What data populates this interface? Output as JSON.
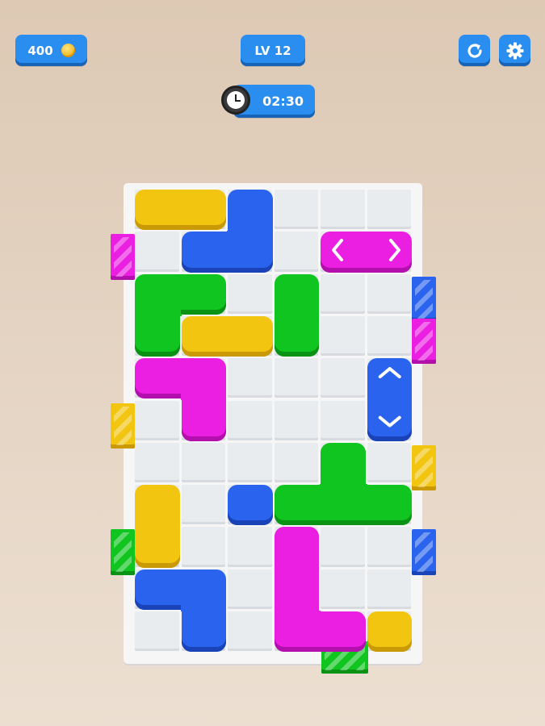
{
  "hud": {
    "coins": "400",
    "level": "LV 12",
    "timer": "02:30"
  },
  "icons": [
    "coin-icon",
    "clock-icon",
    "restart-icon",
    "settings-icon",
    "arrow-left-icon",
    "arrow-right-icon",
    "arrow-up-icon",
    "arrow-down-icon"
  ],
  "colors": {
    "yellow": "#f1c40f",
    "blue": "#2866f0",
    "green": "#0bc21f",
    "magenta": "#e81be0",
    "hud_blue": "#2a8ef0"
  },
  "board": {
    "columns": 6,
    "rows": 11,
    "pieces": [
      {
        "id": "yellow-bar-top",
        "color": "yellow",
        "cells": [
          [
            0,
            0
          ],
          [
            1,
            0
          ]
        ]
      },
      {
        "id": "blue-corner-top",
        "color": "blue",
        "cells": [
          [
            2,
            0
          ],
          [
            2,
            1
          ],
          [
            1,
            1
          ]
        ]
      },
      {
        "id": "magenta-horizontal-arrows",
        "color": "magenta",
        "cells": [
          [
            4,
            1
          ],
          [
            5,
            1
          ]
        ],
        "arrows": "horizontal"
      },
      {
        "id": "green-corner-left",
        "color": "green",
        "cells": [
          [
            0,
            2
          ],
          [
            1,
            2
          ],
          [
            0,
            3
          ]
        ]
      },
      {
        "id": "yellow-bar-middle",
        "color": "yellow",
        "cells": [
          [
            1,
            3
          ],
          [
            2,
            3
          ]
        ]
      },
      {
        "id": "green-vertical",
        "color": "green",
        "cells": [
          [
            3,
            2
          ],
          [
            3,
            3
          ]
        ]
      },
      {
        "id": "magenta-corner",
        "color": "magenta",
        "cells": [
          [
            0,
            4
          ],
          [
            1,
            4
          ],
          [
            1,
            5
          ]
        ]
      },
      {
        "id": "blue-vertical-arrows",
        "color": "blue",
        "cells": [
          [
            5,
            4
          ],
          [
            5,
            5
          ]
        ],
        "arrows": "vertical"
      },
      {
        "id": "green-t",
        "color": "green",
        "cells": [
          [
            4,
            6
          ],
          [
            3,
            7
          ],
          [
            4,
            7
          ],
          [
            5,
            7
          ]
        ]
      },
      {
        "id": "blue-single",
        "color": "blue",
        "cells": [
          [
            2,
            7
          ]
        ]
      },
      {
        "id": "yellow-vertical",
        "color": "yellow",
        "cells": [
          [
            0,
            7
          ],
          [
            0,
            8
          ]
        ]
      },
      {
        "id": "magenta-l",
        "color": "magenta",
        "cells": [
          [
            3,
            8
          ],
          [
            3,
            9
          ],
          [
            3,
            10
          ],
          [
            4,
            10
          ]
        ]
      },
      {
        "id": "blue-corner-bottom",
        "color": "blue",
        "cells": [
          [
            0,
            9
          ],
          [
            1,
            9
          ],
          [
            1,
            10
          ]
        ]
      },
      {
        "id": "yellow-single",
        "color": "yellow",
        "cells": [
          [
            5,
            10
          ]
        ]
      }
    ],
    "gates": [
      {
        "id": "gate-left-magenta",
        "color": "magenta",
        "side": "left",
        "row": 1
      },
      {
        "id": "gate-left-yellow",
        "color": "yellow",
        "side": "left",
        "row": 5
      },
      {
        "id": "gate-left-green",
        "color": "green",
        "side": "left",
        "row": 8
      },
      {
        "id": "gate-right-blue",
        "color": "blue",
        "side": "right",
        "row": 2
      },
      {
        "id": "gate-right-magenta",
        "color": "magenta",
        "side": "right",
        "row": 3
      },
      {
        "id": "gate-right-yellow",
        "color": "yellow",
        "side": "right",
        "row": 6
      },
      {
        "id": "gate-right-blue-2",
        "color": "blue",
        "side": "right",
        "row": 8
      },
      {
        "id": "gate-bottom-green",
        "color": "green",
        "side": "bottom",
        "col": 4
      }
    ]
  }
}
